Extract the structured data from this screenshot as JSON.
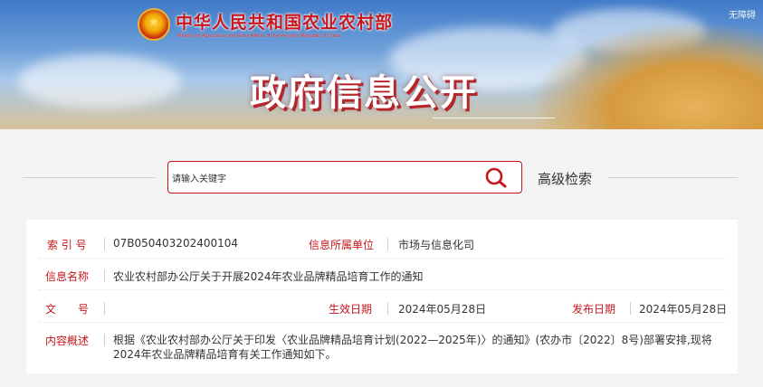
{
  "header": {
    "ministry_cn": "中华人民共和国农业农村部",
    "ministry_en": "Ministry of Agriculture and Rural Affairs of the People's Republic of China",
    "accessible": "无障碍",
    "title": "政府信息公开"
  },
  "search": {
    "placeholder": "请输入关键字",
    "advanced_label": "高级检索"
  },
  "info": {
    "index_label": "索 引 号",
    "index_value": "07B050403202400104",
    "unit_label": "信息所属单位",
    "unit_value": "市场与信息化司",
    "name_label": "信息名称",
    "name_value": "农业农村部办公厅关于开展2024年农业品牌精品培育工作的通知",
    "doc_label": "文　　号",
    "effective_label": "生效日期",
    "effective_value": "2024年05月28日",
    "publish_label": "发布日期",
    "publish_value": "2024年05月28日",
    "summary_label": "内容概述",
    "summary_value": "根据《农业农村部办公厅关于印发〈农业品牌精品培育计划(2022—2025年)〉的通知》(农办市〔2022〕8号)部署安排,现将2024年农业品牌精品培育有关工作通知如下。"
  },
  "colors": {
    "accent": "#c8161d",
    "page_bg": "#f3f3f3"
  },
  "icons": {
    "search": "search-icon",
    "emblem": "national-emblem-icon"
  }
}
